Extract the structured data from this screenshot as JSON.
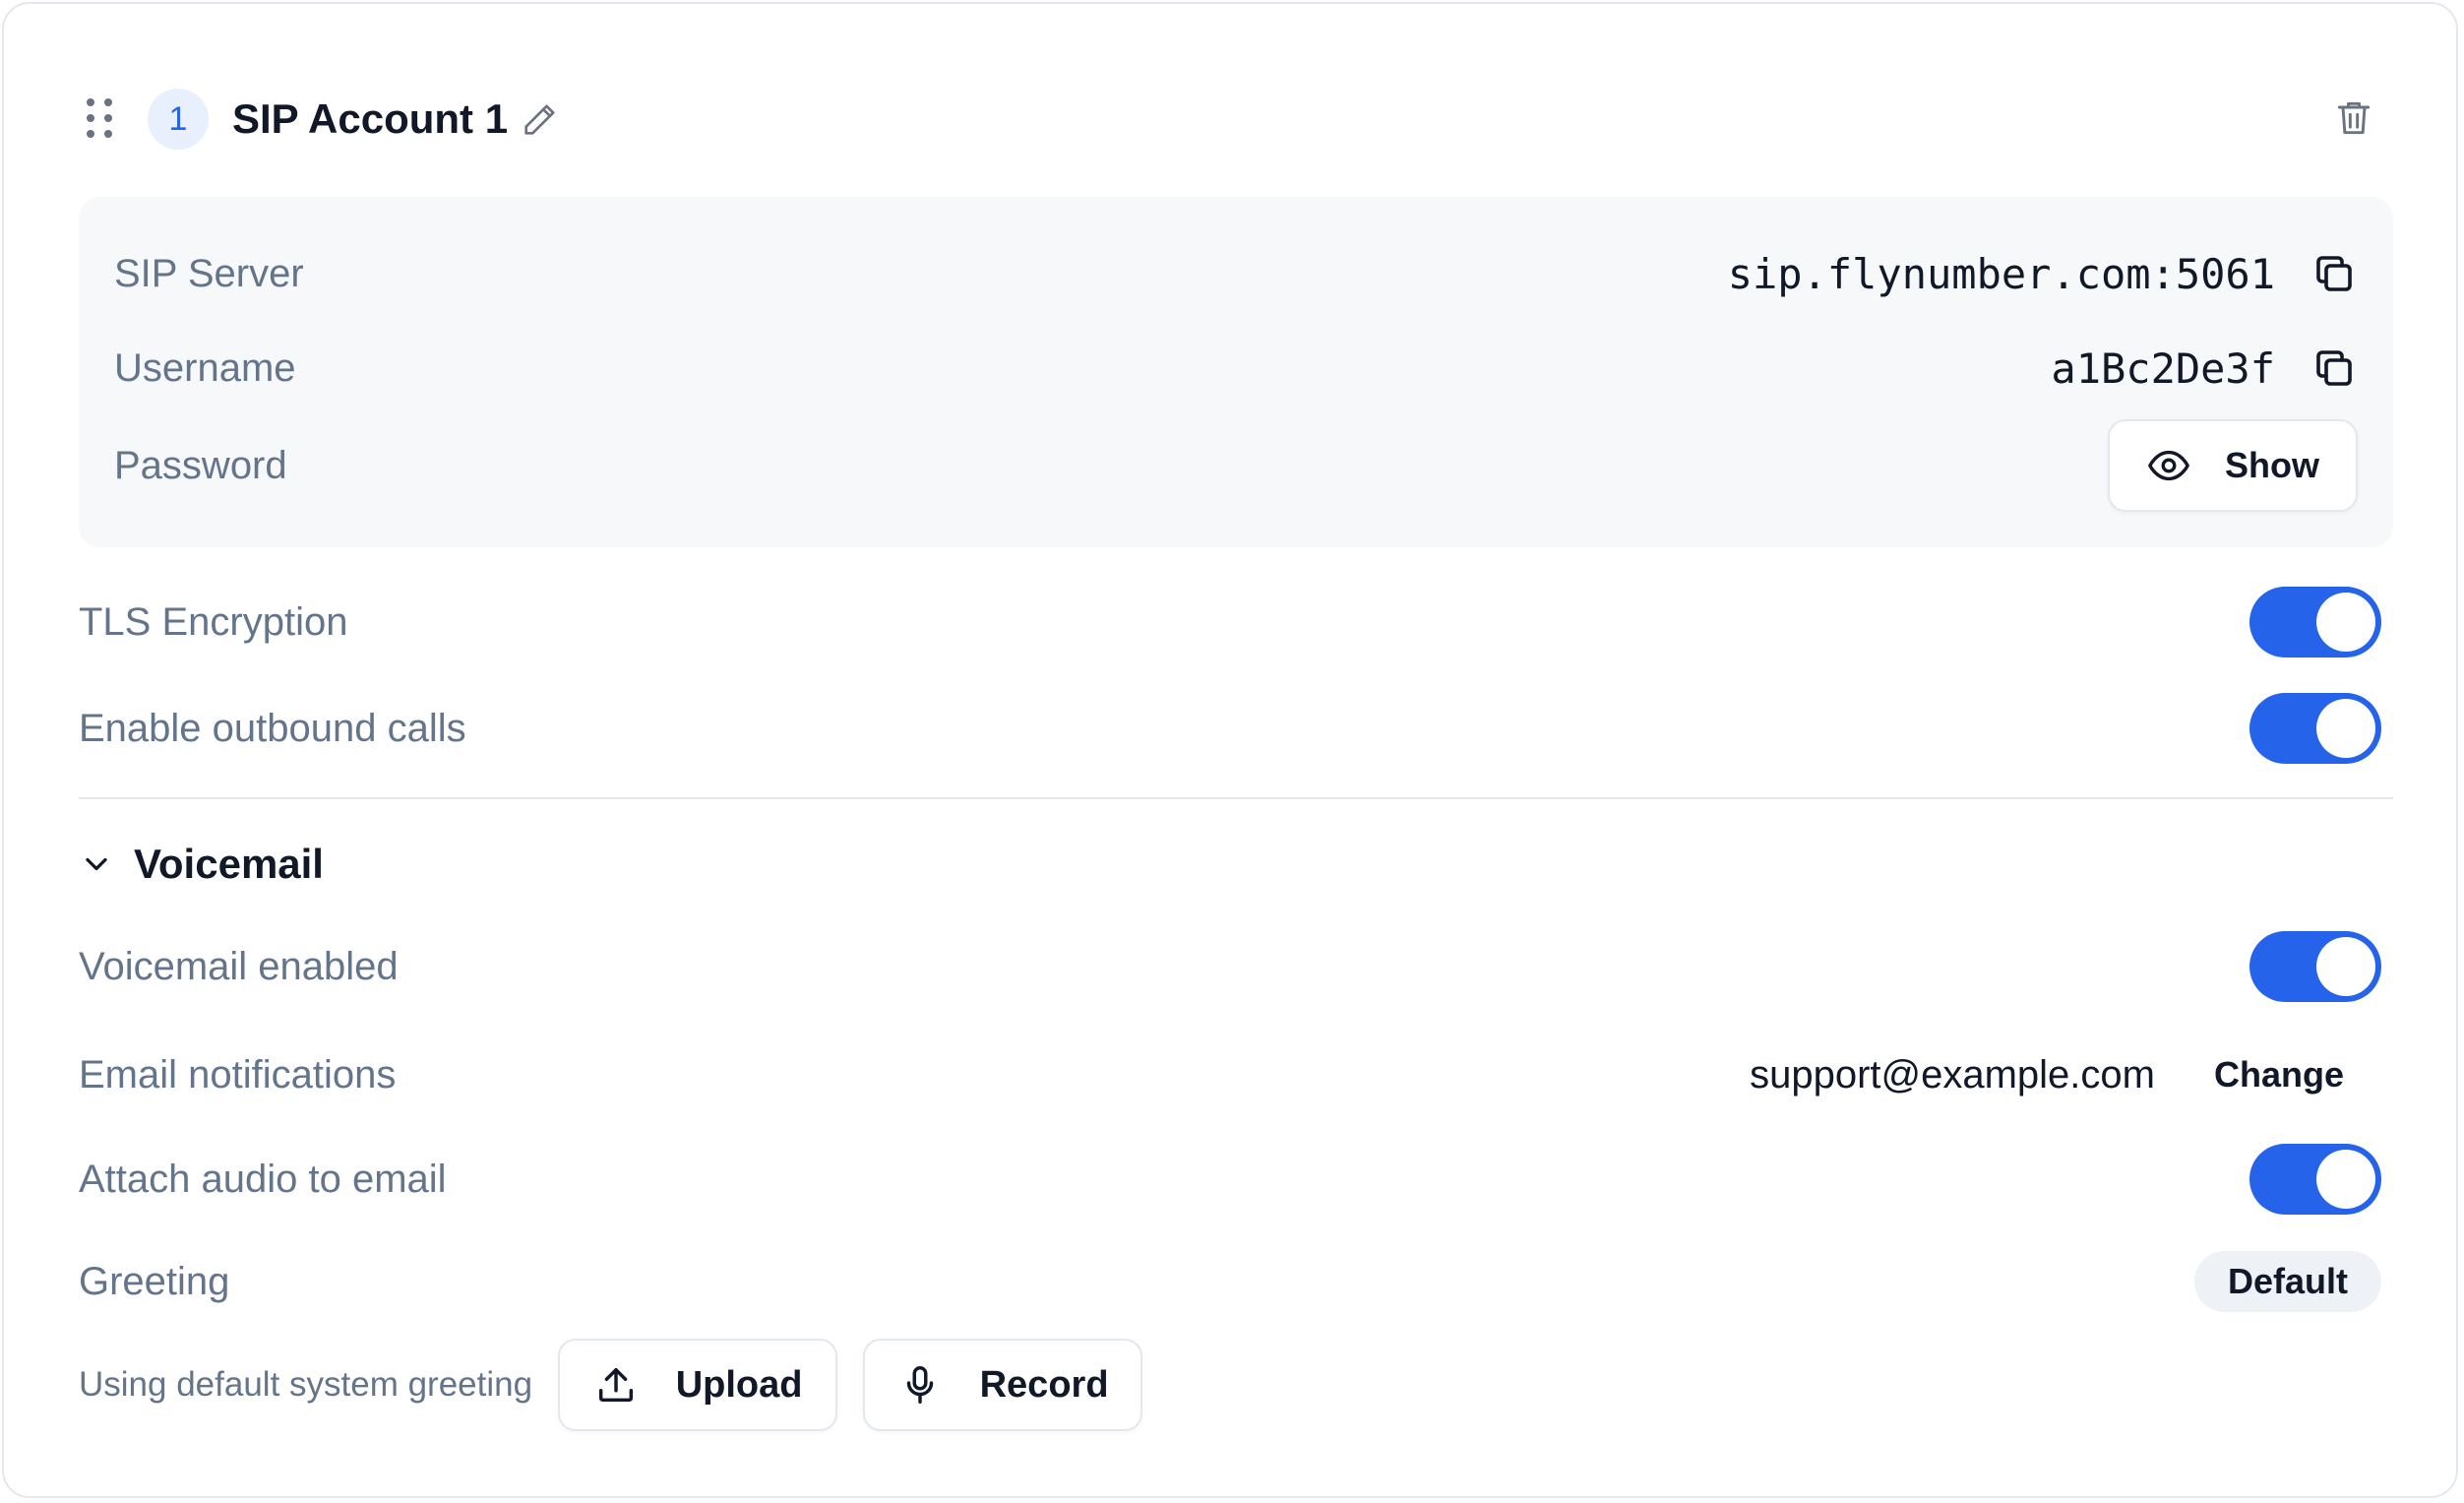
{
  "account": {
    "index": "1",
    "title": "SIP Account 1",
    "icons": {
      "drag": "drag-handle-icon",
      "edit": "pencil-icon",
      "delete": "trash-icon"
    }
  },
  "credentials": {
    "server_label": "SIP Server",
    "server_value": "sip.flynumber.com:5061",
    "username_label": "Username",
    "username_value": "a1Bc2De3f",
    "password_label": "Password",
    "show_label": "Show"
  },
  "settings": {
    "tls_label": "TLS Encryption",
    "tls_enabled": true,
    "outbound_label": "Enable outbound calls",
    "outbound_enabled": true
  },
  "voicemail": {
    "section_title": "Voicemail",
    "enabled_label": "Voicemail enabled",
    "enabled": true,
    "email_label": "Email notifications",
    "email_value": "support@example.com",
    "change_label": "Change",
    "attach_label": "Attach audio to email",
    "attach_enabled": true,
    "greeting_label": "Greeting",
    "greeting_value": "Default",
    "greeting_note": "Using default system greeting",
    "upload_label": "Upload",
    "record_label": "Record"
  },
  "colors": {
    "accent": "#2563eb",
    "muted_text": "#64748b",
    "panel_bg": "#f7f8fa"
  }
}
